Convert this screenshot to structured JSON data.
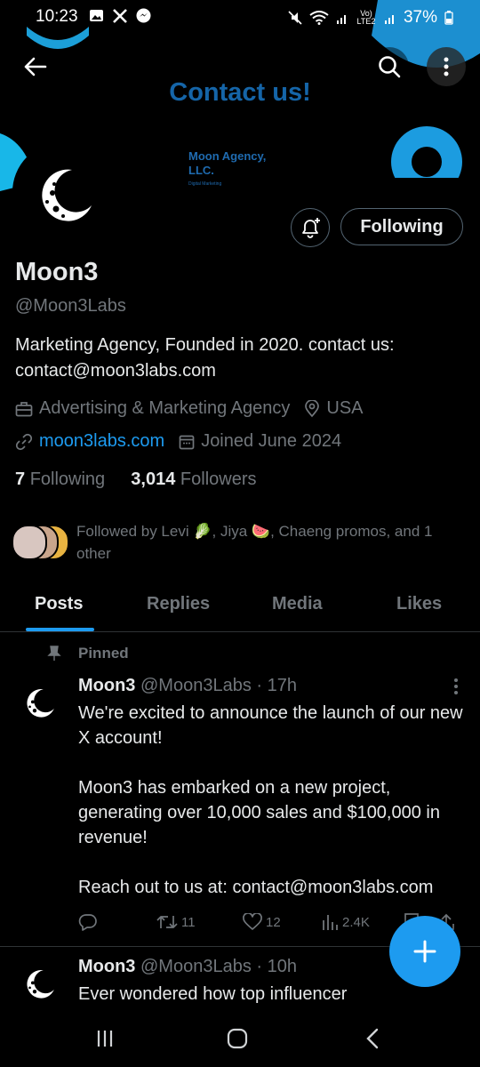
{
  "status_bar": {
    "time": "10:23",
    "network": "Vo) LTE2",
    "battery": "37%"
  },
  "banner": {
    "title": "Contact us!",
    "agency_name": "Moon Agency, LLC.",
    "agency_sub": "Digital Marketing"
  },
  "profile": {
    "name": "Moon3",
    "handle": "@Moon3Labs",
    "bio": "Marketing Agency, Founded in 2020.  contact us: contact@moon3labs.com",
    "category": "Advertising & Marketing Agency",
    "location": "USA",
    "website": "moon3labs.com",
    "joined": "Joined June 2024",
    "following_count": "7",
    "following_label": "Following",
    "followers_count": "3,014",
    "followers_label": "Followers",
    "followed_by": "Followed by Levi 🥬, Jiya 🍉, Chaeng promos, and 1 other",
    "follow_button": "Following"
  },
  "tabs": [
    "Posts",
    "Replies",
    "Media",
    "Likes"
  ],
  "posts": [
    {
      "pinned_label": "Pinned",
      "author": "Moon3",
      "handle": "@Moon3Labs",
      "time": "· 17h",
      "paragraphs": [
        "We're excited to announce the launch of our new X account!",
        "Moon3 has embarked on a new project, generating over 10,000 sales and $100,000 in revenue!",
        "Reach out to us at: contact@moon3labs.com"
      ],
      "reposts": "11",
      "likes": "12",
      "views": "2.4K"
    },
    {
      "author": "Moon3",
      "handle": "@Moon3Labs",
      "time": "· 10h",
      "text": "Ever wondered how top influencer"
    }
  ],
  "colors": {
    "accent": "#1d9bf0",
    "background": "#000000",
    "muted": "#71767b",
    "banner_title": "#1565a8"
  }
}
